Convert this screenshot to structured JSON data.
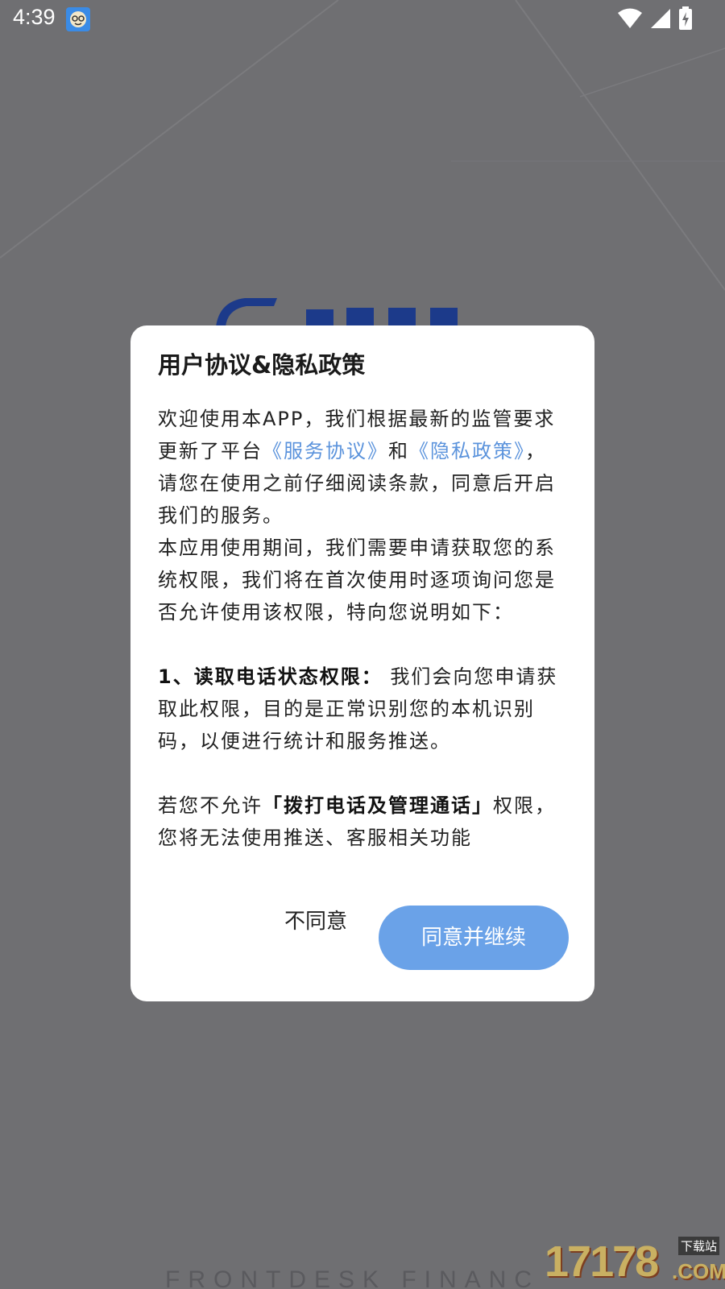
{
  "status_bar": {
    "time": "4:39"
  },
  "background": {
    "footer_text": "FRONTDESK FINANC"
  },
  "watermark": {
    "number": "17178",
    "site_label": "下载站",
    "domain": ".COM"
  },
  "dialog": {
    "title": "用户协议&隐私政策",
    "para1": {
      "text_a": "欢迎使用本APP，我们根据最新的监管要求更新了平台",
      "link_service": "《服务协议》",
      "text_b": "和",
      "link_privacy": "《隐私政策》",
      "text_c": "，请您在使用之前仔细阅读条款，同意后开启我们的服务。"
    },
    "para2": "本应用使用期间，我们需要申请获取您的系统权限，我们将在首次使用时逐项询问您是否允许使用该权限，特向您说明如下：",
    "para3": {
      "bold": "1、读取电话状态权限：",
      "text": " 我们会向您申请获取此权限，目的是正常识别您的本机识别码，以便进行统计和服务推送。"
    },
    "para4": {
      "text_a": "若您不允许",
      "bold": "「拨打电话及管理通话」",
      "text_b": "权限，您将无法使用推送、客服相关功能"
    },
    "disagree_label": "不同意",
    "agree_label": "同意并继续"
  },
  "colors": {
    "overlay": "#6f6f72",
    "link": "#5b93dc",
    "agree_button": "#6aa2e8"
  },
  "icons": [
    "app-notification-icon",
    "wifi-icon",
    "signal-icon",
    "battery-charging-icon"
  ]
}
